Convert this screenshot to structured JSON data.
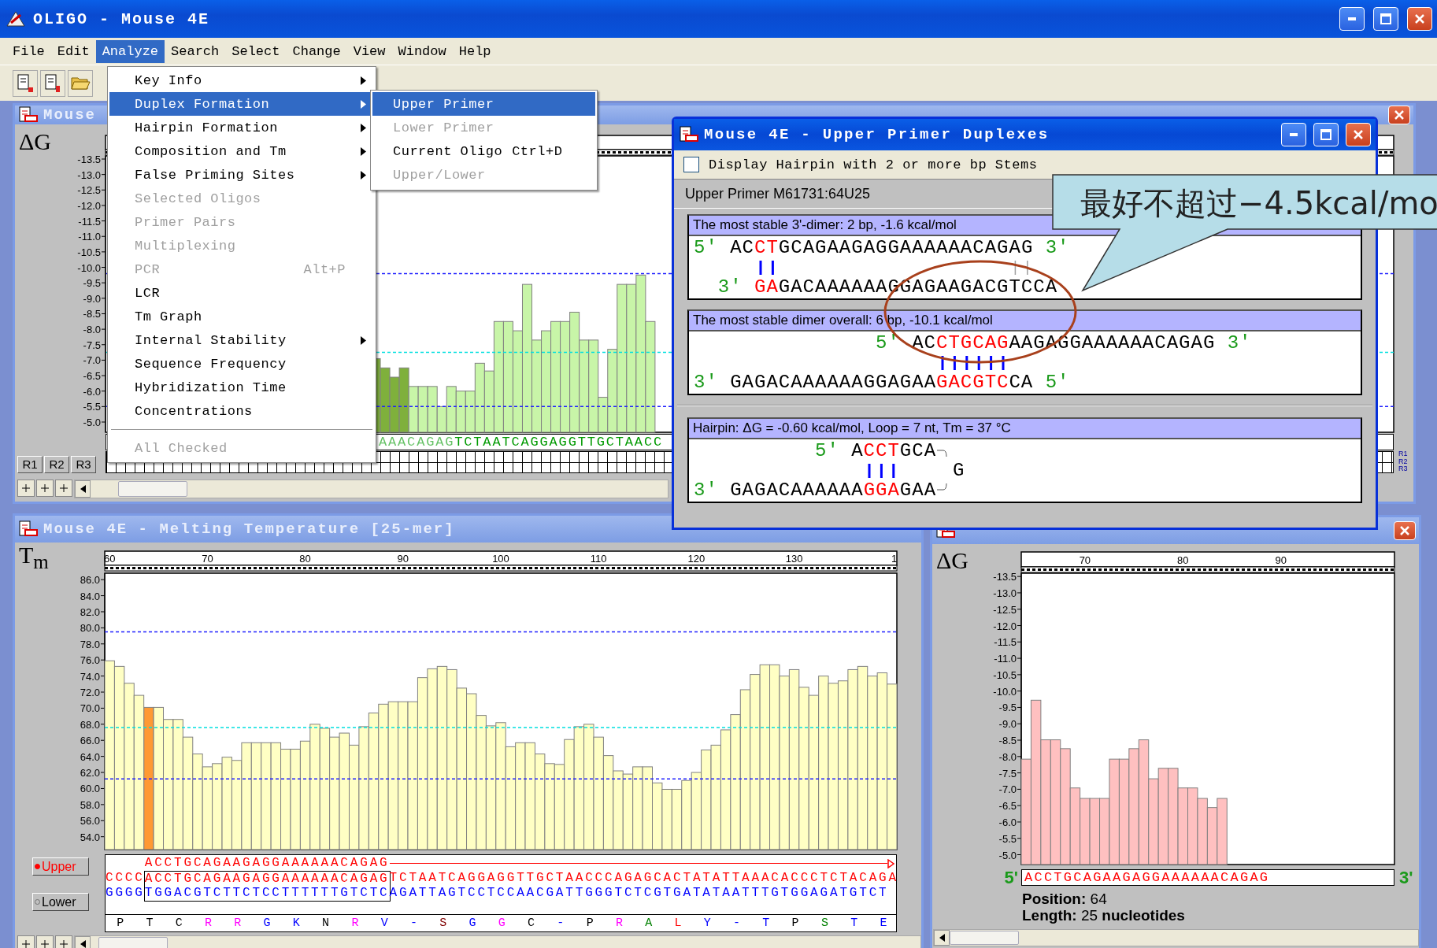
{
  "window": {
    "title": "OLIGO - Mouse 4E"
  },
  "menu_bar": [
    {
      "label": "File",
      "selected": false
    },
    {
      "label": "Edit",
      "selected": false
    },
    {
      "label": "Analyze",
      "selected": true
    },
    {
      "label": "Search",
      "selected": false
    },
    {
      "label": "Select",
      "selected": false
    },
    {
      "label": "Change",
      "selected": false
    },
    {
      "label": "View",
      "selected": false
    },
    {
      "label": "Window",
      "selected": false
    },
    {
      "label": "Help",
      "selected": false
    }
  ],
  "analyze_menu": [
    {
      "kind": "item",
      "label": "Key Info",
      "submenu": true,
      "disabled": false,
      "selected": false
    },
    {
      "kind": "item",
      "label": "Duplex Formation",
      "submenu": true,
      "disabled": false,
      "selected": true
    },
    {
      "kind": "item",
      "label": "Hairpin Formation",
      "submenu": true,
      "disabled": false,
      "selected": false
    },
    {
      "kind": "item",
      "label": "Composition and Tm",
      "submenu": true,
      "disabled": false,
      "selected": false
    },
    {
      "kind": "item",
      "label": "False Priming Sites",
      "submenu": true,
      "disabled": false,
      "selected": false
    },
    {
      "kind": "item",
      "label": "Selected Oligos",
      "submenu": false,
      "disabled": true,
      "selected": false
    },
    {
      "kind": "item",
      "label": "Primer Pairs",
      "submenu": false,
      "disabled": true,
      "selected": false
    },
    {
      "kind": "item",
      "label": "Multiplexing",
      "submenu": false,
      "disabled": true,
      "selected": false
    },
    {
      "kind": "item",
      "label": "PCR",
      "shortcut": "Alt+P",
      "submenu": false,
      "disabled": true,
      "selected": false
    },
    {
      "kind": "item",
      "label": "LCR",
      "submenu": false,
      "disabled": false,
      "selected": false
    },
    {
      "kind": "item",
      "label": "Tm Graph",
      "submenu": false,
      "disabled": false,
      "selected": false
    },
    {
      "kind": "item",
      "label": "Internal Stability",
      "submenu": true,
      "disabled": false,
      "selected": false
    },
    {
      "kind": "item",
      "label": "Sequence Frequency",
      "submenu": false,
      "disabled": false,
      "selected": false
    },
    {
      "kind": "item",
      "label": "Hybridization Time",
      "submenu": false,
      "disabled": false,
      "selected": false
    },
    {
      "kind": "item",
      "label": "Concentrations",
      "submenu": false,
      "disabled": false,
      "selected": false
    },
    {
      "kind": "separator"
    },
    {
      "kind": "item",
      "label": "All Checked",
      "submenu": false,
      "disabled": true,
      "selected": false
    }
  ],
  "duplex_submenu": [
    {
      "kind": "item",
      "label": "Upper Primer",
      "disabled": false,
      "selected": true
    },
    {
      "kind": "item",
      "label": "Lower Primer",
      "disabled": true,
      "selected": false
    },
    {
      "kind": "item",
      "label": "Current Oligo",
      "shortcut": "Ctrl+D",
      "disabled": false,
      "selected": false
    },
    {
      "kind": "item",
      "label": "Upper/Lower",
      "disabled": true,
      "selected": false
    }
  ],
  "dg_window": {
    "title": "Mouse",
    "axis_label": "ΔG",
    "tick_labels": [
      "-13.5",
      "-13.0",
      "-12.5",
      "-12.0",
      "-11.5",
      "-11.0",
      "-10.5",
      "-10.0",
      "-9.5",
      "-9.0",
      "-8.5",
      "-8.0",
      "-7.5",
      "-7.0",
      "-6.5",
      "-6.0",
      "-5.5",
      "-5.0"
    ],
    "sequence": [
      {
        "kind": "primer",
        "text": "AAACAGAG"
      },
      {
        "kind": "flank",
        "text": "TCTAATCAGGAGGTTGCTAACC"
      }
    ],
    "range_buttons": [
      "R1",
      "R2",
      "R3"
    ],
    "side_labels": [
      "R1",
      "R2",
      "R3"
    ]
  },
  "duplex_dialog": {
    "title": "Mouse 4E - Upper Primer Duplexes",
    "checkbox": {
      "label": "Display Hairpin with 2 or more bp Stems",
      "checked": false
    },
    "primer_label": "Upper Primer M61731:64U25",
    "panels": [
      {
        "header": "The most stable 3'-dimer: 2 bp, -1.6 kcal/mol",
        "top": [
          {
            "kind": "end",
            "text": "5'"
          },
          {
            "kind": "base",
            "text": "AC"
          },
          {
            "kind": "paired",
            "text": "CT"
          },
          {
            "kind": "base",
            "text": "GCAGAAGAGGAAAAAACAG"
          },
          {
            "kind": "weak",
            "text": "AG"
          },
          {
            "kind": "end",
            "text": "3'"
          }
        ],
        "bottom": [
          {
            "kind": "end",
            "text": "3'"
          },
          {
            "kind": "paired",
            "text": "GA"
          },
          {
            "kind": "base",
            "text": "GACAAAAAAGGAGAAGACG"
          },
          {
            "kind": "weak",
            "text": "TC"
          },
          {
            "kind": "base",
            "text": "CA"
          }
        ]
      },
      {
        "header": "The most stable dimer overall: 6 bp, -10.1 kcal/mol",
        "top": [
          {
            "kind": "end",
            "text": "5'"
          },
          {
            "kind": "base",
            "text": "AC"
          },
          {
            "kind": "paired",
            "text": "CTGCAG"
          },
          {
            "kind": "base",
            "text": "AAGAGGAAAAAACAGAG"
          },
          {
            "kind": "end",
            "text": "3'"
          }
        ],
        "bottom": [
          {
            "kind": "end",
            "text": "3'"
          },
          {
            "kind": "base",
            "text": "GAGACAAAAAAGGAGAA"
          },
          {
            "kind": "paired",
            "text": "GACGTC"
          },
          {
            "kind": "base",
            "text": "CA"
          },
          {
            "kind": "end",
            "text": "5'"
          }
        ]
      },
      {
        "header": "Hairpin: ΔG = -0.60 kcal/mol, Loop = 7 nt, Tm = 37 °C",
        "top": [
          {
            "kind": "end",
            "text": "5'"
          },
          {
            "kind": "base",
            "text": "A"
          },
          {
            "kind": "paired",
            "text": "CCT"
          },
          {
            "kind": "base",
            "text": "GCA"
          }
        ],
        "bottom": [
          {
            "kind": "end",
            "text": "3'"
          },
          {
            "kind": "base",
            "text": "GAGACAAAAAA"
          },
          {
            "kind": "paired",
            "text": "GGA"
          },
          {
            "kind": "base",
            "text": "GAA"
          }
        ],
        "loop": "G"
      }
    ]
  },
  "callout": {
    "text": "最好不超过−4.5kcal/mo"
  },
  "tm_window": {
    "title": "Mouse 4E - Melting Temperature [25-mer]",
    "axis_label": "T$_{m}$",
    "ruler_end_label": "1",
    "chart_data": {
      "type": "bar",
      "xlim": [
        59.5,
        140.5
      ],
      "ylim": [
        52.4,
        86.8
      ],
      "yticks": [
        {
          "value": 54,
          "label": "54.0"
        },
        {
          "value": 56,
          "label": "56.0"
        },
        {
          "value": 58,
          "label": "58.0"
        },
        {
          "value": 60,
          "label": "60.0"
        },
        {
          "value": 62,
          "label": "62.0"
        },
        {
          "value": 64,
          "label": "64.0"
        },
        {
          "value": 66,
          "label": "66.0"
        },
        {
          "value": 68,
          "label": "68.0"
        },
        {
          "value": 70,
          "label": "70.0"
        },
        {
          "value": 72,
          "label": "72.0"
        },
        {
          "value": 74,
          "label": "74.0"
        },
        {
          "value": 76,
          "label": "76.0"
        },
        {
          "value": 78,
          "label": "78.0"
        },
        {
          "value": 80,
          "label": "80.0"
        },
        {
          "value": 82,
          "label": "82.0"
        },
        {
          "value": 84,
          "label": "84.0"
        },
        {
          "value": 86,
          "label": "86.0"
        }
      ],
      "xticks": [
        60,
        70,
        80,
        90,
        100,
        110,
        120,
        130
      ],
      "x": [
        60,
        61,
        62,
        63,
        64,
        65,
        66,
        67,
        68,
        69,
        70,
        71,
        72,
        73,
        74,
        75,
        76,
        77,
        78,
        79,
        80,
        81,
        82,
        83,
        84,
        85,
        86,
        87,
        88,
        89,
        90,
        91,
        92,
        93,
        94,
        95,
        96,
        97,
        98,
        99,
        100,
        101,
        102,
        103,
        104,
        105,
        106,
        107,
        108,
        109,
        110,
        111,
        112,
        113,
        114,
        115,
        116,
        117,
        118,
        119,
        120,
        121,
        122,
        123,
        124,
        125,
        126,
        127,
        128,
        129,
        130,
        131,
        132,
        133,
        134,
        135,
        136,
        137,
        138,
        139,
        140
      ],
      "series": [
        {
          "color": "#ff9933",
          "values": [
            null,
            null,
            null,
            null,
            70.1,
            null,
            null,
            null,
            null,
            null,
            null,
            null,
            null,
            null,
            null,
            null,
            null,
            null,
            null,
            null,
            null,
            null,
            null,
            null,
            null,
            null,
            null,
            null,
            null,
            null,
            null,
            null,
            null,
            null,
            null,
            null,
            null,
            null,
            null,
            null,
            null,
            null,
            null,
            null,
            null,
            null,
            null,
            null,
            null,
            null,
            null,
            null,
            null,
            null,
            null,
            null,
            null,
            null,
            null,
            null,
            null,
            null,
            null,
            null,
            null,
            null,
            null,
            null,
            null,
            null,
            null,
            null,
            null,
            null,
            null,
            null,
            null,
            null,
            null,
            null,
            null
          ]
        },
        {
          "color": "#ffffc4",
          "values": [
            75.9,
            75.2,
            73.1,
            71.6,
            null,
            70.1,
            68.6,
            68.6,
            66.4,
            64.3,
            62.7,
            63.1,
            63.9,
            63.5,
            65.7,
            65.7,
            65.7,
            65.7,
            64.9,
            64.9,
            65.9,
            68.0,
            67.5,
            66.4,
            66.9,
            65.4,
            67.7,
            69.4,
            70.5,
            70.8,
            70.8,
            70.8,
            73.8,
            74.9,
            75.2,
            74.8,
            72.5,
            71.8,
            69.1,
            67.8,
            68.2,
            65.2,
            65.7,
            65.7,
            64.3,
            63.1,
            63.0,
            66.1,
            67.7,
            68.0,
            66.4,
            64.1,
            62.2,
            61.8,
            62.7,
            62.7,
            60.7,
            59.9,
            59.9,
            61.0,
            62.0,
            64.8,
            65.4,
            67.3,
            69.2,
            72.3,
            74.2,
            75.4,
            75.4,
            74.0,
            74.8,
            72.6,
            71.6,
            74.0,
            73.1,
            73.4,
            74.8,
            75.2,
            74.0,
            74.4,
            73.0
          ]
        }
      ],
      "ref_lines": [
        {
          "axis": "y",
          "value": 79.5,
          "color": "#2020ff"
        },
        {
          "axis": "y",
          "value": 67.6,
          "color": "#00e0e0"
        },
        {
          "axis": "y",
          "value": 61.2,
          "color": "#2020ff"
        }
      ]
    },
    "strand_buttons": [
      {
        "label": "Upper",
        "selected": true
      },
      {
        "label": "Lower",
        "selected": false
      }
    ],
    "primer_row": {
      "text": "ACCTGCAGAAGAGGAAAAAACAGAG",
      "color": "#ff0000"
    },
    "strands": [
      {
        "color": "#ff0000",
        "segments": [
          {
            "kind": "flank",
            "text": "CCCC"
          },
          {
            "kind": "primer",
            "text": "ACCTGCAGAAGAGGAAAAAACAGAG"
          },
          {
            "kind": "flank",
            "text": "TCTAATCAGGAGGTTGCTAACCCAGAGCACTATATTAAACACCCTCTACAGA"
          }
        ]
      },
      {
        "color": "#0000ff",
        "segments": [
          {
            "kind": "flank",
            "text": "GGGG"
          },
          {
            "kind": "primer",
            "text": "TGGACGTCTTCTCCTTTTTTGTCTC"
          },
          {
            "kind": "flank",
            "text": "AGATTAGTCCTCCAACGATTGGGTCTCGTGATATAATTTGTGGAGATGTCT"
          }
        ]
      }
    ],
    "translation": [
      {
        "text": "P",
        "color": "#000000"
      },
      {
        "text": "T",
        "color": "#000000"
      },
      {
        "text": "C",
        "color": "#000000"
      },
      {
        "text": "R",
        "color": "#ff00ff"
      },
      {
        "text": "R",
        "color": "#ff00ff"
      },
      {
        "text": "G",
        "color": "#0000ff"
      },
      {
        "text": "K",
        "color": "#0000ff"
      },
      {
        "text": "N",
        "color": "#000000"
      },
      {
        "text": "R",
        "color": "#ff00ff"
      },
      {
        "text": "V",
        "color": "#0000ff"
      },
      {
        "text": "-",
        "color": "#0000ff"
      },
      {
        "text": "S",
        "color": "#800000"
      },
      {
        "text": "G",
        "color": "#0000ff"
      },
      {
        "text": "G",
        "color": "#ff00ff"
      },
      {
        "text": "C",
        "color": "#000000"
      },
      {
        "text": "-",
        "color": "#0000ff"
      },
      {
        "text": "P",
        "color": "#000000"
      },
      {
        "text": "R",
        "color": "#ff00ff"
      },
      {
        "text": "A",
        "color": "#008000"
      },
      {
        "text": "L",
        "color": "#ff0000"
      },
      {
        "text": "Y",
        "color": "#0000ff"
      },
      {
        "text": "-",
        "color": "#0000ff"
      },
      {
        "text": "T",
        "color": "#0000ff"
      },
      {
        "text": "P",
        "color": "#000000"
      },
      {
        "text": "S",
        "color": "#008000"
      },
      {
        "text": "T",
        "color": "#0000ff"
      },
      {
        "text": "E",
        "color": "#0000ff"
      }
    ]
  },
  "dg_primer_window": {
    "axis_label": "ΔG",
    "chart_data": {
      "type": "bar",
      "xlim": [
        63.5,
        101.6
      ],
      "ylim": [
        -4.7,
        -13.6
      ],
      "yticks": [
        -13.5,
        {
          "value": -13,
          "label": "-13.0"
        },
        -12.5,
        {
          "value": -12,
          "label": "-12.0"
        },
        -11.5,
        {
          "value": -11,
          "label": "-11.0"
        },
        -10.5,
        {
          "value": -10,
          "label": "-10.0"
        },
        -9.5,
        {
          "value": -9,
          "label": "-9.0"
        },
        -8.5,
        {
          "value": -8,
          "label": "-8.0"
        },
        -7.5,
        {
          "value": -7,
          "label": "-7.0"
        },
        -6.5,
        {
          "value": -6,
          "label": "-6.0"
        },
        -5.5,
        {
          "value": -5,
          "label": "-5.0"
        }
      ],
      "xticks": [
        70,
        80,
        90
      ],
      "x": [
        64,
        65,
        66,
        67,
        68,
        69,
        70,
        71,
        72,
        73,
        74,
        75,
        76,
        77,
        78,
        79,
        80,
        81,
        82,
        83,
        84
      ],
      "series": [
        {
          "color": "#ffc0c0",
          "values": [
            -7.92,
            -9.72,
            -8.51,
            -8.51,
            -8.24,
            -7.04,
            -6.72,
            -6.72,
            -6.72,
            -7.92,
            -7.92,
            -8.24,
            -8.51,
            -7.32,
            -7.64,
            -7.64,
            -7.04,
            -7.04,
            -6.72,
            -6.44,
            -6.72
          ]
        }
      ]
    },
    "five_prime": "5'",
    "three_prime": "3'",
    "sequence": "ACCTGCAGAAGAGGAAAAAACAGAG",
    "position": "**Position:** 64",
    "length": "**Length:** 25 **nucleotides**"
  }
}
